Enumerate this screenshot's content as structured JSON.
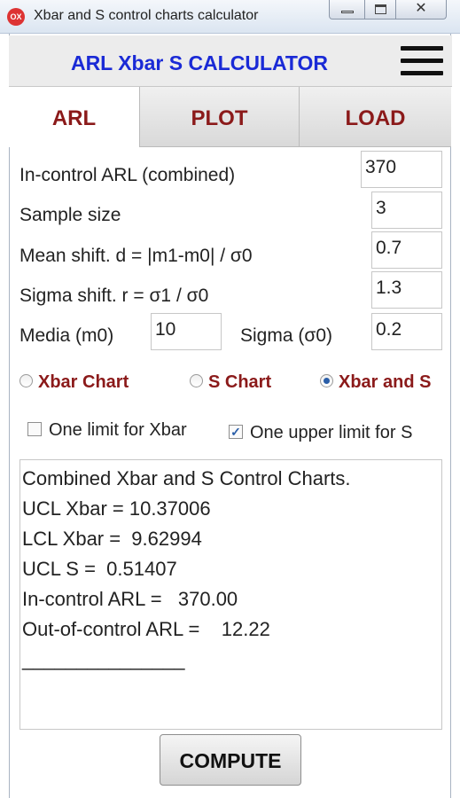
{
  "window": {
    "title": "Xbar and S control charts calculator",
    "icon_text": "OX",
    "minimize_label": "—",
    "maximize_label": "",
    "close_label": "✕"
  },
  "header": {
    "title": "ARL Xbar S CALCULATOR",
    "menu_icon": "hamburger-icon"
  },
  "tabs": [
    {
      "label": "ARL",
      "active": true
    },
    {
      "label": "PLOT",
      "active": false
    },
    {
      "label": "LOAD",
      "active": false
    }
  ],
  "form": {
    "arl_label": "In-control ARL (combined)",
    "arl_value": "370",
    "sample_size_label": "Sample size",
    "sample_size_value": "3",
    "mean_shift_label": "Mean shift. d = |m1-m0| / σ0",
    "mean_shift_value": "0.7",
    "sigma_shift_label": "Sigma shift. r = σ1 / σ0",
    "sigma_shift_value": "1.3",
    "media_label": "Media (m0)",
    "media_value": "10",
    "sigma_label": "Sigma (σ0)",
    "sigma_value": "0.2"
  },
  "chart_type": {
    "options": [
      "Xbar Chart",
      "S Chart",
      "Xbar and S"
    ],
    "selected": "Xbar and S"
  },
  "limits": {
    "one_limit_xbar_label": "One limit for Xbar",
    "one_limit_xbar_checked": false,
    "one_upper_limit_s_label": "One upper limit for S",
    "one_upper_limit_s_checked": true
  },
  "results": {
    "lines": [
      "Combined Xbar and S Control Charts.",
      "UCL Xbar = 10.37006",
      "LCL Xbar =  9.62994",
      "UCL S =  0.51407",
      "In-control ARL =   370.00",
      "Out-of-control ARL =    12.22"
    ],
    "separator": "_______________"
  },
  "compute_label": "COMPUTE",
  "colors": {
    "title_blue": "#1a2ad6",
    "tab_red": "#8b1a1a",
    "radio_selected": "#2a5ea8"
  }
}
